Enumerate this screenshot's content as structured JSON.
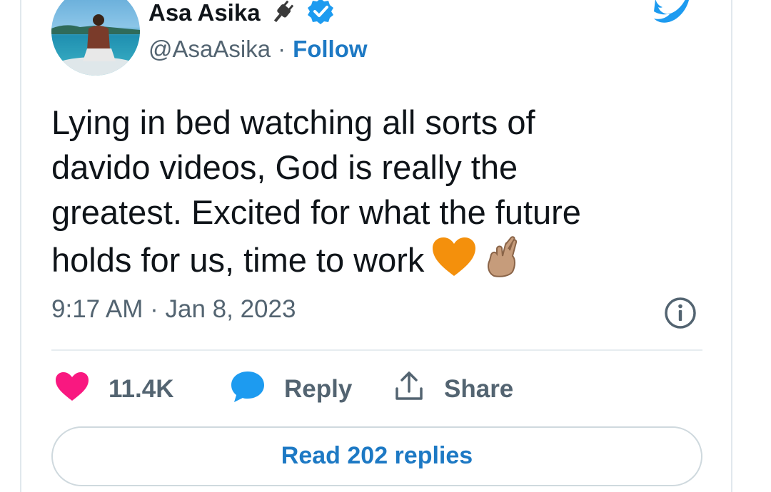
{
  "author": {
    "name": "Asa Asika",
    "handle": "@AsaAsika",
    "separator": "·",
    "follow_label": "Follow",
    "badges": [
      "plug-icon",
      "verified-badge-icon"
    ]
  },
  "tweet": {
    "lines": [
      "Lying in bed watching all sorts of",
      "davido videos, God is really the",
      "greatest. Excited for what the future",
      "holds for us, time to work"
    ],
    "emojis": [
      "orange-heart-emoji",
      "crossed-fingers-emoji"
    ],
    "timestamp": "9:17 AM · Jan 8, 2023"
  },
  "actions": {
    "like_count": "11.4K",
    "reply_label": "Reply",
    "share_label": "Share"
  },
  "read_replies_label": "Read 202 replies",
  "colors": {
    "accent": "#1d79c4",
    "twitter_blue": "#1d9bf0",
    "heart": "#f91880",
    "muted_text": "#536471",
    "text": "#0f1419",
    "orange_heart": "#f4900c"
  }
}
